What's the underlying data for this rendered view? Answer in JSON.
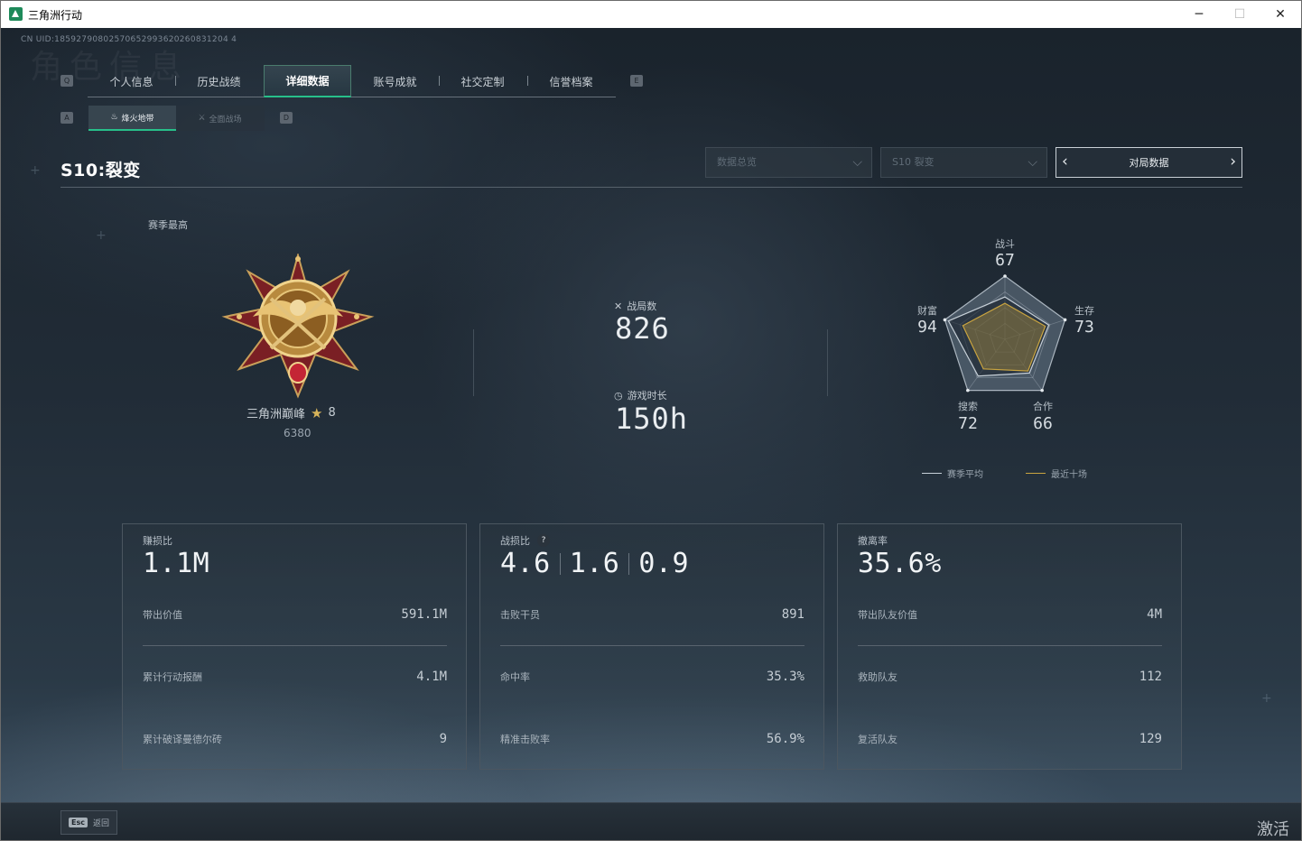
{
  "window": {
    "title": "三角洲行动",
    "controls": {
      "minimize": "─",
      "maximize": "☐",
      "close": "✕"
    }
  },
  "uid": "CN UID:18592790802570652993620260831204 4",
  "ghost_title": "角色信息",
  "nav": {
    "left_key": "Q",
    "right_key": "E",
    "tabs": [
      {
        "label": "个人信息"
      },
      {
        "label": "历史战绩"
      },
      {
        "label": "详细数据"
      },
      {
        "label": "账号成就"
      },
      {
        "label": "社交定制"
      },
      {
        "label": "信誉档案"
      }
    ],
    "active_index": 2
  },
  "subnav": {
    "left_key": "A",
    "right_key": "D",
    "tabs": [
      {
        "label": "烽火地带",
        "icon": "hazard-zone-icon"
      },
      {
        "label": "全面战场",
        "icon": "warfare-icon"
      }
    ],
    "active_index": 0
  },
  "season": {
    "title": "S10:裂变",
    "dropdown_overview": "数据总览",
    "dropdown_season": "S10 裂变",
    "match_data_button": "对局数据"
  },
  "rank": {
    "section_label": "赛季最高",
    "name": "三角洲巅峰",
    "stars": "8",
    "points": "6380"
  },
  "overview": {
    "matches_label": "战局数",
    "matches_value": "826",
    "playtime_label": "游戏时长",
    "playtime_value": "150h"
  },
  "radar": {
    "axes": [
      {
        "label": "战斗",
        "value": "67"
      },
      {
        "label": "生存",
        "value": "73"
      },
      {
        "label": "合作",
        "value": "66"
      },
      {
        "label": "搜索",
        "value": "72"
      },
      {
        "label": "财富",
        "value": "94"
      }
    ],
    "season_avg": [
      67,
      73,
      66,
      72,
      94
    ],
    "recent_ten": [
      57,
      67,
      62,
      58,
      70
    ],
    "max": 100,
    "legend_season": "赛季平均",
    "legend_recent": "最近十场",
    "colors": {
      "season": "#c7d0d8",
      "recent": "#c9a440"
    }
  },
  "cards": [
    {
      "title": "赚损比",
      "big": "1.1M",
      "rows": [
        {
          "k": "带出价值",
          "v": "591.1M"
        },
        {
          "k": "累计行动报酬",
          "v": "4.1M"
        },
        {
          "k": "累计破译曼德尔砖",
          "v": "9"
        }
      ]
    },
    {
      "title": "战损比",
      "big_parts": [
        "4.6",
        "1.6",
        "0.9"
      ],
      "help": "?",
      "rows": [
        {
          "k": "击败干员",
          "v": "891"
        },
        {
          "k": "命中率",
          "v": "35.3%"
        },
        {
          "k": "精准击败率",
          "v": "56.9%"
        }
      ]
    },
    {
      "title": "撤离率",
      "big": "35.6%",
      "rows": [
        {
          "k": "带出队友价值",
          "v": "4M"
        },
        {
          "k": "救助队友",
          "v": "112"
        },
        {
          "k": "复活队友",
          "v": "129"
        }
      ]
    }
  ],
  "bottom": {
    "esc_key": "Esc",
    "back_label": "返回"
  },
  "watermark": "激活"
}
